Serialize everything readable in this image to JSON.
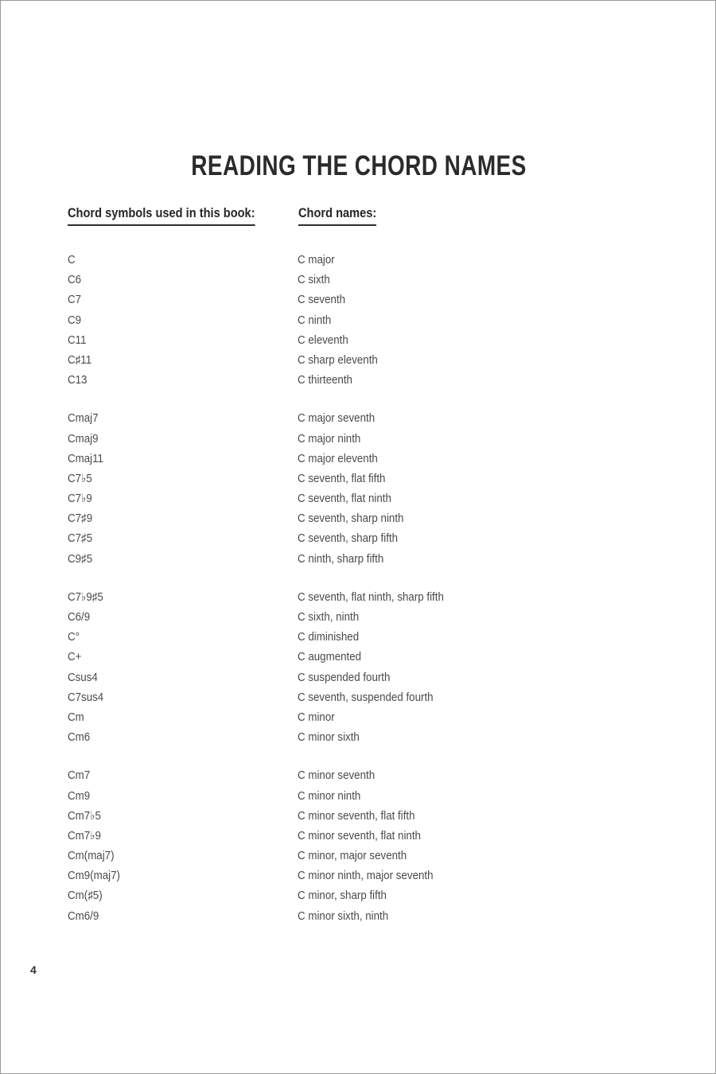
{
  "document": {
    "title": "READING THE CHORD NAMES",
    "page_number": "4"
  },
  "table": {
    "headers": {
      "symbols": "Chord symbols used in this book:",
      "names": "Chord names:"
    },
    "groups": [
      {
        "rows": [
          {
            "symbol": "C",
            "name": "C major"
          },
          {
            "symbol": "C6",
            "name": "C sixth"
          },
          {
            "symbol": "C7",
            "name": "C seventh"
          },
          {
            "symbol": "C9",
            "name": "C ninth"
          },
          {
            "symbol": "C11",
            "name": "C eleventh"
          },
          {
            "symbol": "C♯11",
            "name": "C sharp eleventh"
          },
          {
            "symbol": "C13",
            "name": "C thirteenth"
          }
        ]
      },
      {
        "rows": [
          {
            "symbol": "Cmaj7",
            "name": "C major seventh"
          },
          {
            "symbol": "Cmaj9",
            "name": "C major ninth"
          },
          {
            "symbol": "Cmaj11",
            "name": "C major eleventh"
          },
          {
            "symbol": "C7♭5",
            "name": "C seventh, flat fifth"
          },
          {
            "symbol": "C7♭9",
            "name": "C seventh, flat ninth"
          },
          {
            "symbol": "C7♯9",
            "name": "C seventh, sharp ninth"
          },
          {
            "symbol": "C7♯5",
            "name": "C seventh, sharp fifth"
          },
          {
            "symbol": "C9♯5",
            "name": "C ninth, sharp fifth"
          }
        ]
      },
      {
        "rows": [
          {
            "symbol": "C7♭9♯5",
            "name": "C seventh, flat ninth, sharp fifth"
          },
          {
            "symbol": "C6/9",
            "name": "C sixth, ninth"
          },
          {
            "symbol": "C°",
            "name": "C diminished"
          },
          {
            "symbol": "C+",
            "name": "C augmented"
          },
          {
            "symbol": "Csus4",
            "name": "C suspended fourth"
          },
          {
            "symbol": "C7sus4",
            "name": "C seventh, suspended fourth"
          },
          {
            "symbol": "Cm",
            "name": "C minor"
          },
          {
            "symbol": "Cm6",
            "name": "C minor sixth"
          }
        ]
      },
      {
        "rows": [
          {
            "symbol": "Cm7",
            "name": "C minor seventh"
          },
          {
            "symbol": "Cm9",
            "name": "C minor ninth"
          },
          {
            "symbol": "Cm7♭5",
            "name": "C minor seventh, flat fifth"
          },
          {
            "symbol": "Cm7♭9",
            "name": "C minor seventh, flat ninth"
          },
          {
            "symbol": "Cm(maj7)",
            "name": "C minor, major seventh"
          },
          {
            "symbol": "Cm9(maj7)",
            "name": "C minor ninth, major seventh"
          },
          {
            "symbol": "Cm(♯5)",
            "name": "C minor, sharp fifth"
          },
          {
            "symbol": "Cm6/9",
            "name": "C minor sixth, ninth"
          }
        ]
      }
    ]
  }
}
